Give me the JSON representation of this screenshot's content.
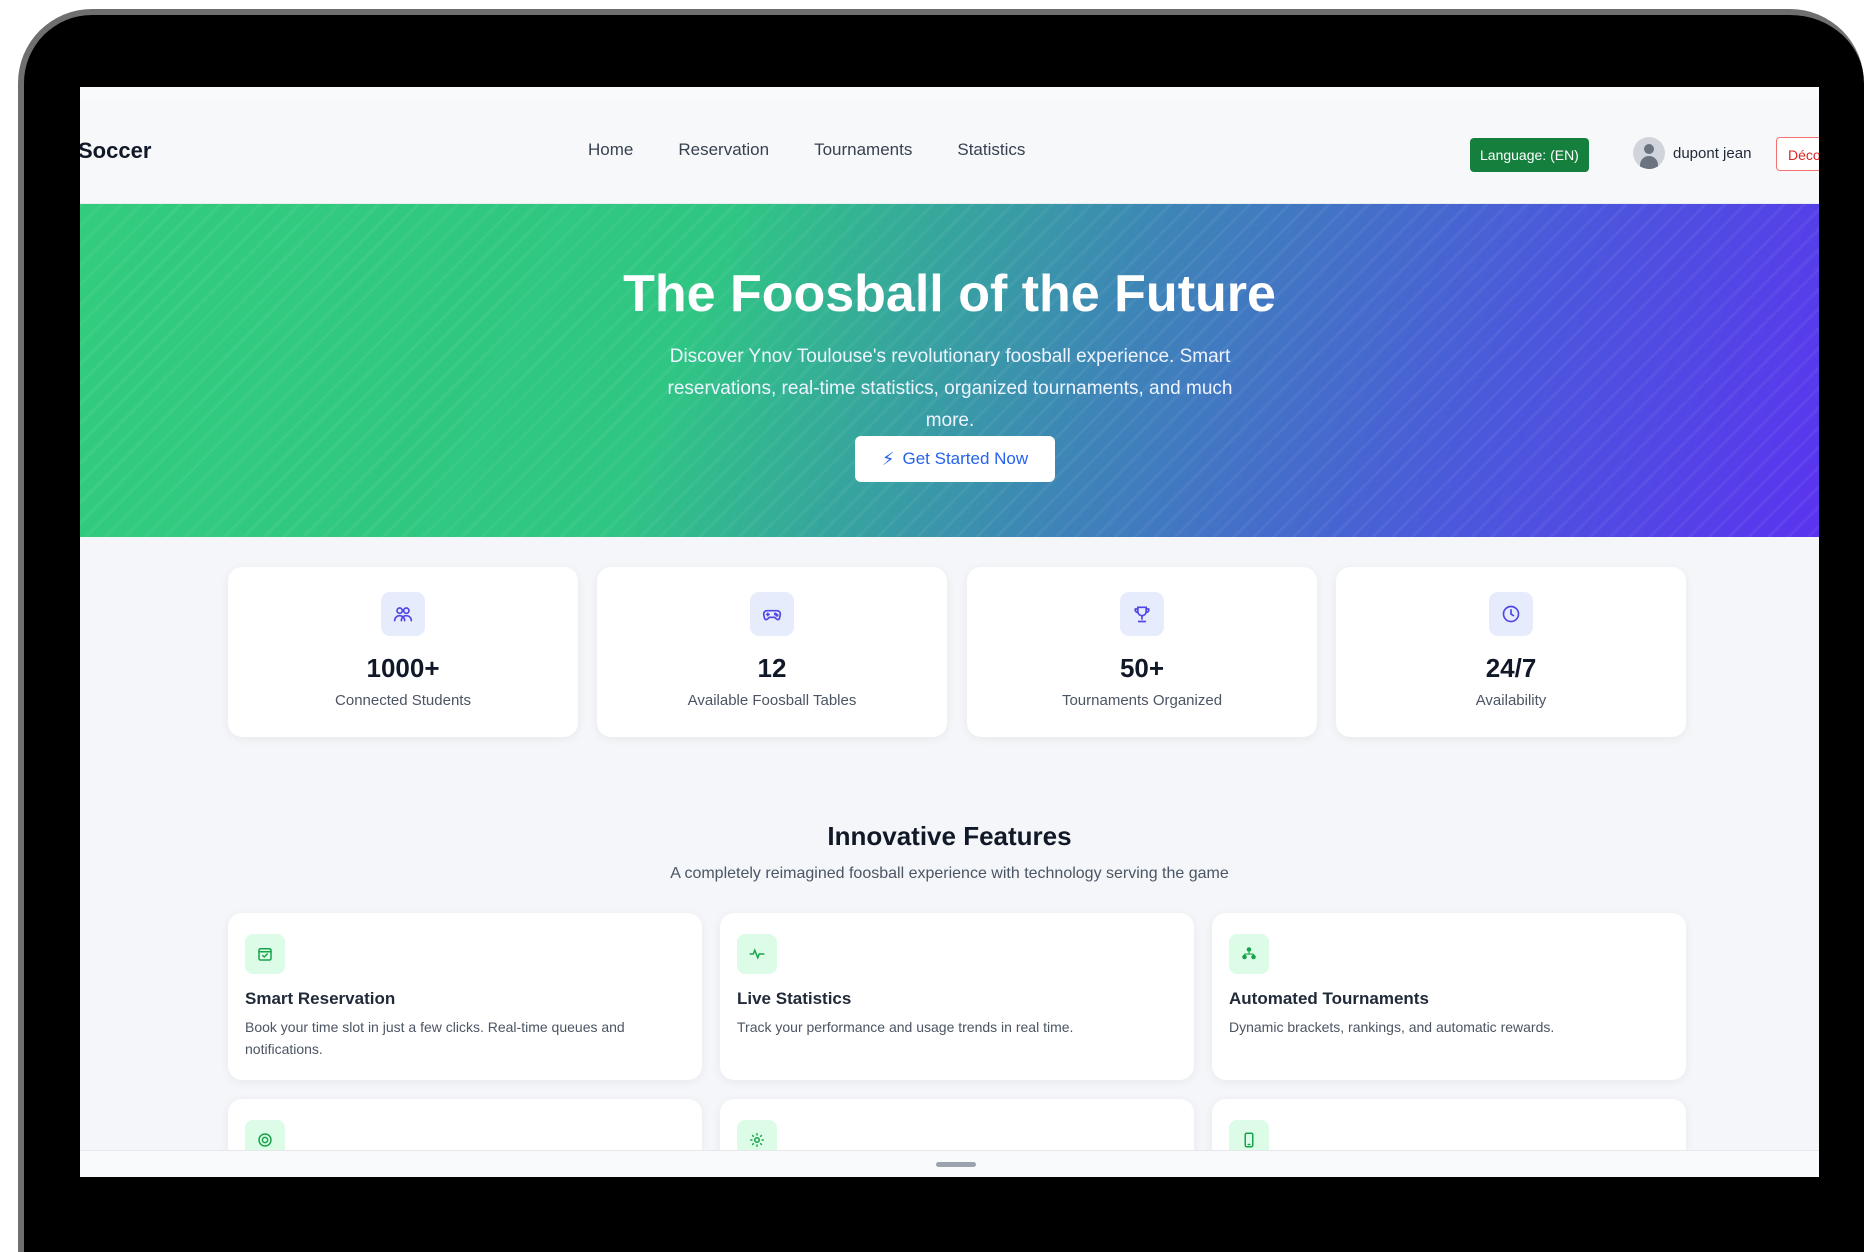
{
  "navbar": {
    "brand": "Soccer",
    "links": [
      "Home",
      "Reservation",
      "Tournaments",
      "Statistics"
    ],
    "language_label": "Language: (EN)",
    "user_name": "dupont jean",
    "logout_label": "Déco"
  },
  "hero": {
    "title": "The Foosball of the Future",
    "subtitle": "Discover Ynov Toulouse's revolutionary foosball experience. Smart reservations, real-time statistics, organized tournaments, and much more.",
    "cta_label": "Get Started Now"
  },
  "stats": [
    {
      "icon": "users-icon",
      "value": "1000+",
      "label": "Connected Students"
    },
    {
      "icon": "gamepad-icon",
      "value": "12",
      "label": "Available Foosball Tables"
    },
    {
      "icon": "trophy-icon",
      "value": "50+",
      "label": "Tournaments Organized"
    },
    {
      "icon": "clock-icon",
      "value": "24/7",
      "label": "Availability"
    }
  ],
  "features": {
    "title": "Innovative Features",
    "subtitle": "A completely reimagined foosball experience with technology serving the game",
    "items": [
      {
        "icon": "calendar-check-icon",
        "name": "Smart Reservation",
        "description": "Book your time slot in just a few clicks. Real-time queues and notifications."
      },
      {
        "icon": "activity-icon",
        "name": "Live Statistics",
        "description": "Track your performance and usage trends in real time."
      },
      {
        "icon": "bracket-icon",
        "name": "Automated Tournaments",
        "description": "Dynamic brackets, rankings, and automatic rewards."
      },
      {
        "icon": "target-icon",
        "name": "",
        "description": ""
      },
      {
        "icon": "gear-icon",
        "name": "",
        "description": ""
      },
      {
        "icon": "smartphone-icon",
        "name": "",
        "description": ""
      }
    ]
  },
  "colors": {
    "primary": "#2563eb",
    "accent_green": "#15803d",
    "danger": "#dc2626",
    "hero_start": "#33cc7d",
    "hero_end": "#5a33ef"
  }
}
